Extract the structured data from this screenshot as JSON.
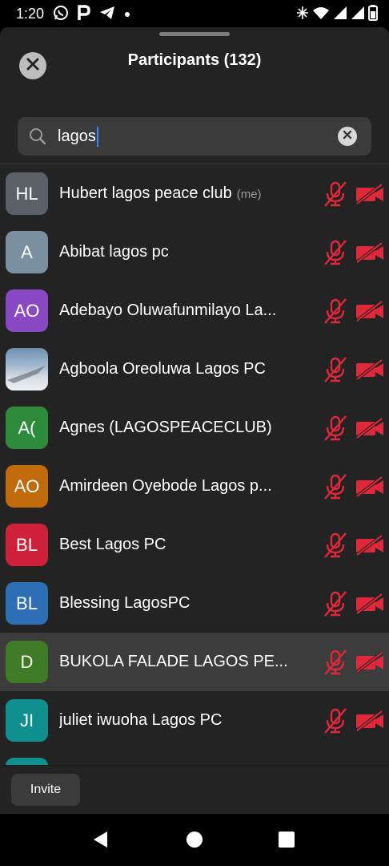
{
  "status_bar": {
    "time": "1:20",
    "icons_left": [
      "whatsapp-icon",
      "p-app-icon",
      "telegram-icon",
      "dot-icon"
    ],
    "icons_right": [
      "alarm-icon",
      "wifi-icon",
      "signal-icon",
      "signal-icon",
      "battery-icon"
    ]
  },
  "header": {
    "title": "Participants (132)",
    "close_icon": "close-icon"
  },
  "search": {
    "value": "lagos",
    "search_icon": "search-icon",
    "clear_icon": "clear-icon"
  },
  "participants": [
    {
      "initials": "HL",
      "name": "Hubert lagos peace club",
      "tag": "(me)",
      "avatar_color": "#5b6068"
    },
    {
      "initials": "A",
      "name": "Abibat lagos pc",
      "tag": "",
      "avatar_color": "#7a8f9f"
    },
    {
      "initials": "AO",
      "name": "Adebayo Oluwafunmilayo La...",
      "tag": "",
      "avatar_color": "#8a49c4"
    },
    {
      "initials": "",
      "name": "Agboola Oreoluwa Lagos PC",
      "tag": "",
      "avatar_color": "photo"
    },
    {
      "initials": "A(",
      "name": "Agnes (LAGOSPEACECLUB)",
      "tag": "",
      "avatar_color": "#2e8b3c"
    },
    {
      "initials": "AO",
      "name": "Amirdeen Oyebode Lagos p...",
      "tag": "",
      "avatar_color": "#c06a0a"
    },
    {
      "initials": "BL",
      "name": "Best Lagos PC",
      "tag": "",
      "avatar_color": "#d0213a"
    },
    {
      "initials": "BL",
      "name": "Blessing LagosPC",
      "tag": "",
      "avatar_color": "#2c6fb4"
    },
    {
      "initials": "D",
      "name": "BUKOLA FALADE LAGOS PE...",
      "tag": "",
      "avatar_color": "#3f7a26"
    },
    {
      "initials": "JI",
      "name": "juliet iwuoha Lagos PC",
      "tag": "",
      "avatar_color": "#0f8f8d"
    },
    {
      "initials": "",
      "name": "",
      "tag": "",
      "avatar_color": "#0f8f8d"
    }
  ],
  "mic_icon": "mic-muted-icon",
  "cam_icon": "video-off-icon",
  "colors": {
    "muted_red": "#e0283a",
    "sheet_bg": "#232323",
    "highlight_row": "#3c3c3c"
  },
  "bottom": {
    "invite_label": "Invite"
  },
  "nav": [
    "back-icon",
    "home-icon",
    "recents-icon"
  ]
}
